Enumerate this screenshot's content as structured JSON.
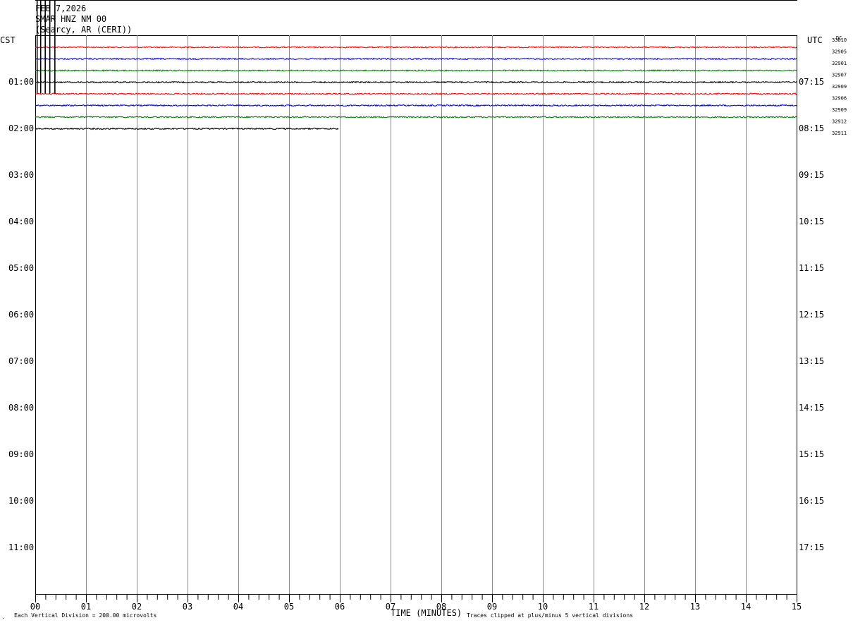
{
  "header": {
    "date": "FEB 7,2026",
    "station": "SMAR HNZ NM 00",
    "location": "(Searcy, AR (CERI))"
  },
  "left_tz": "CST",
  "right_tz": "UTC",
  "dc_label": "DC",
  "footer": {
    "scale_note": "Each Vertical Division =  200.00 microvolts",
    "clip_note": "Traces clipped at plus/minus 5 vertical divisions",
    "corner_mark": "."
  },
  "chart_data": {
    "type": "line",
    "xlabel": "TIME (MINUTES)",
    "xlim": [
      0,
      15
    ],
    "x_ticks": [
      "00",
      "01",
      "02",
      "03",
      "04",
      "05",
      "06",
      "07",
      "08",
      "09",
      "10",
      "11",
      "12",
      "13",
      "14",
      "15"
    ],
    "minor_ticks_per_minute": 5,
    "row_minutes": 15,
    "total_rows": 48,
    "grid": true,
    "left_hour_labels": [
      {
        "row": 4,
        "label": "01:00"
      },
      {
        "row": 8,
        "label": "02:00"
      },
      {
        "row": 12,
        "label": "03:00"
      },
      {
        "row": 16,
        "label": "04:00"
      },
      {
        "row": 20,
        "label": "05:00"
      },
      {
        "row": 24,
        "label": "06:00"
      },
      {
        "row": 28,
        "label": "07:00"
      },
      {
        "row": 32,
        "label": "08:00"
      },
      {
        "row": 36,
        "label": "09:00"
      },
      {
        "row": 40,
        "label": "10:00"
      },
      {
        "row": 44,
        "label": "11:00"
      }
    ],
    "right_hour_labels": [
      {
        "row": 4,
        "label": "07:15"
      },
      {
        "row": 8,
        "label": "08:15"
      },
      {
        "row": 12,
        "label": "09:15"
      },
      {
        "row": 16,
        "label": "10:15"
      },
      {
        "row": 20,
        "label": "11:15"
      },
      {
        "row": 24,
        "label": "12:15"
      },
      {
        "row": 28,
        "label": "13:15"
      },
      {
        "row": 32,
        "label": "14:15"
      },
      {
        "row": 36,
        "label": "15:15"
      },
      {
        "row": 40,
        "label": "16:15"
      },
      {
        "row": 44,
        "label": "17:15"
      }
    ],
    "trace_colors": [
      "#ff0000",
      "#0000ff",
      "#008000",
      "#000000"
    ],
    "traces": [
      {
        "row": 1,
        "end_minute": 15,
        "dc": "32905"
      },
      {
        "row": 2,
        "end_minute": 15,
        "dc": "32901"
      },
      {
        "row": 3,
        "end_minute": 15,
        "dc": "32907"
      },
      {
        "row": 4,
        "end_minute": 15,
        "dc": "32909"
      },
      {
        "row": 5,
        "end_minute": 15,
        "dc": "32906"
      },
      {
        "row": 6,
        "end_minute": 15,
        "dc": "32909"
      },
      {
        "row": 7,
        "end_minute": 15,
        "dc": "32912"
      },
      {
        "row": 8,
        "end_minute": 5.98,
        "dc": "32911"
      }
    ],
    "extra_dc": [
      {
        "row": 0,
        "dc": "33810"
      }
    ],
    "spikes_minutes": [
      0.03,
      0.1,
      0.19,
      0.28,
      0.38
    ]
  }
}
